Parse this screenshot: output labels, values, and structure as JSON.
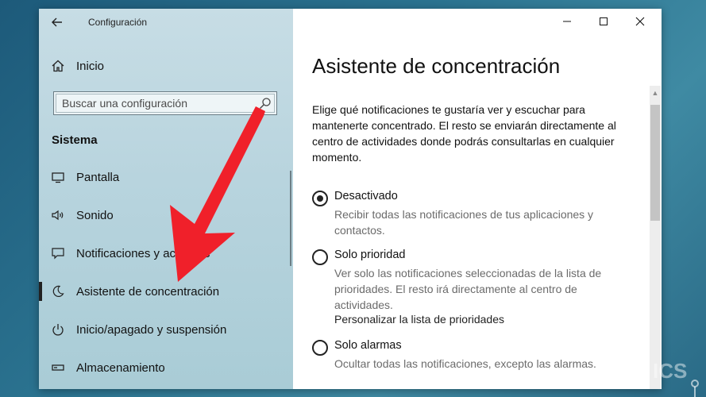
{
  "window": {
    "title": "Configuración"
  },
  "sidebar": {
    "home_label": "Inicio",
    "search_placeholder": "Buscar una configuración",
    "section_heading": "Sistema",
    "items": [
      {
        "label": "Pantalla",
        "icon": "monitor-icon"
      },
      {
        "label": "Sonido",
        "icon": "speaker-icon"
      },
      {
        "label": "Notificaciones y acciones",
        "icon": "notification-icon"
      },
      {
        "label": "Asistente de concentración",
        "icon": "moon-icon",
        "selected": true
      },
      {
        "label": "Inicio/apagado y suspensión",
        "icon": "power-icon"
      },
      {
        "label": "Almacenamiento",
        "icon": "storage-icon"
      }
    ]
  },
  "main": {
    "title": "Asistente de concentración",
    "description": "Elige qué notificaciones te gustaría ver y escuchar para mantenerte concentrado. El resto se enviarán directamente al centro de actividades donde podrás consultarlas en cualquier momento.",
    "options": [
      {
        "label": "Desactivado",
        "description": "Recibir todas las notificaciones de tus aplicaciones y contactos.",
        "checked": true
      },
      {
        "label": "Solo prioridad",
        "description": "Ver solo las notificaciones seleccionadas de la lista de prioridades. El resto irá directamente al centro de actividades.",
        "link": "Personalizar la lista de prioridades",
        "checked": false
      },
      {
        "label": "Solo alarmas",
        "description": "Ocultar todas las notificaciones, excepto las alarmas.",
        "checked": false
      }
    ]
  },
  "overlay": {
    "watermark": "ICS",
    "arrow_color": "#f0202a"
  }
}
